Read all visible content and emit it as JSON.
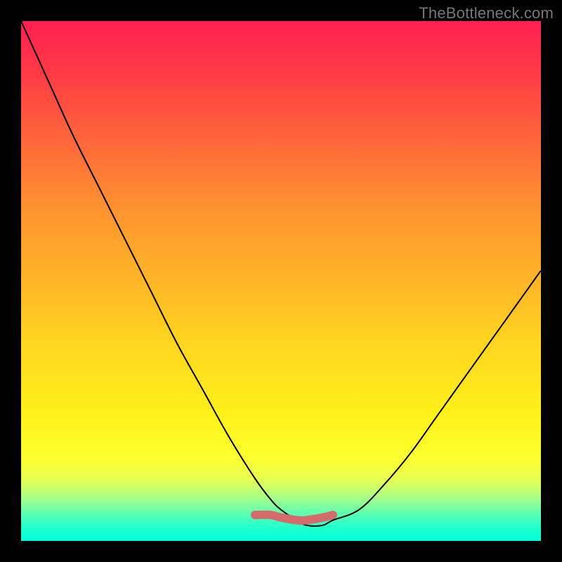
{
  "watermark": "TheBottleneck.com",
  "colors": {
    "background": "#000000",
    "gradient_top": "#ff1f52",
    "gradient_mid": "#ffd520",
    "gradient_bottom": "#00ffd8",
    "curve": "#000000",
    "marker": "#d46a6a"
  },
  "chart_data": {
    "type": "line",
    "title": "",
    "subtitle": "",
    "xlabel": "",
    "ylabel": "",
    "xlim": [
      0,
      100
    ],
    "ylim": [
      0,
      100
    ],
    "grid": false,
    "legend": false,
    "annotations": [],
    "series": [
      {
        "name": "bottleneck-curve",
        "x": [
          0,
          5,
          10,
          15,
          20,
          25,
          30,
          35,
          40,
          45,
          48,
          50,
          53,
          55,
          58,
          60,
          65,
          70,
          75,
          80,
          85,
          90,
          95,
          100
        ],
        "y": [
          100,
          89,
          78,
          68,
          58,
          48,
          38,
          29,
          20,
          12,
          8,
          6,
          4,
          3,
          3,
          4,
          6,
          11,
          17,
          24,
          31,
          38,
          45,
          52
        ]
      },
      {
        "name": "optimal-range-marker",
        "x": [
          45,
          48,
          50,
          53,
          55,
          58,
          60
        ],
        "y": [
          5,
          5,
          4.5,
          4,
          4,
          4.5,
          5
        ]
      }
    ]
  }
}
